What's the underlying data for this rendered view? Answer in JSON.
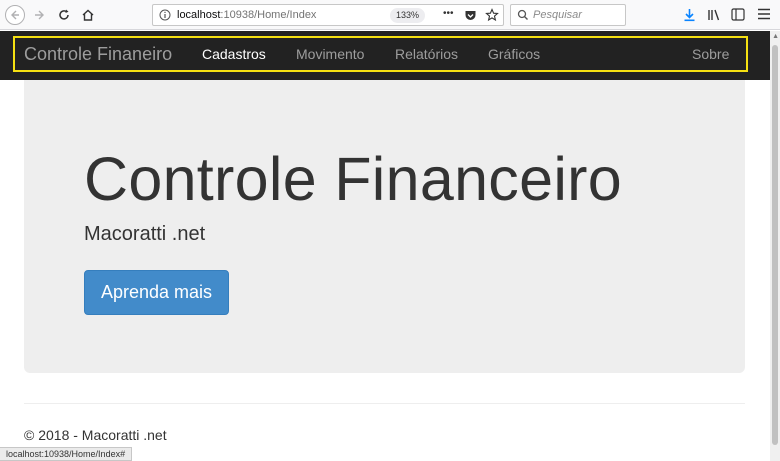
{
  "browser": {
    "url_host": "localhost",
    "url_rest": ":10938/Home/Index",
    "zoom": "133%",
    "search_placeholder": "Pesquisar",
    "more_label": "•••"
  },
  "navbar": {
    "brand": "Controle Finaneiro",
    "items": [
      {
        "label": "Cadastros"
      },
      {
        "label": "Movimento"
      },
      {
        "label": "Relatórios"
      },
      {
        "label": "Gráficos"
      }
    ],
    "about": "Sobre",
    "highlight_color": "#f5e012"
  },
  "jumbotron": {
    "title": "Controle Financeiro",
    "subtitle": "Macoratti .net",
    "button_label": "Aprenda mais"
  },
  "footer": {
    "text": "© 2018 - Macoratti .net"
  },
  "status_bar": {
    "text": "localhost:10938/Home/Index#"
  },
  "colors": {
    "navbar_bg": "#222222",
    "primary": "#428bca",
    "jumbotron_bg": "#eeeeee"
  }
}
